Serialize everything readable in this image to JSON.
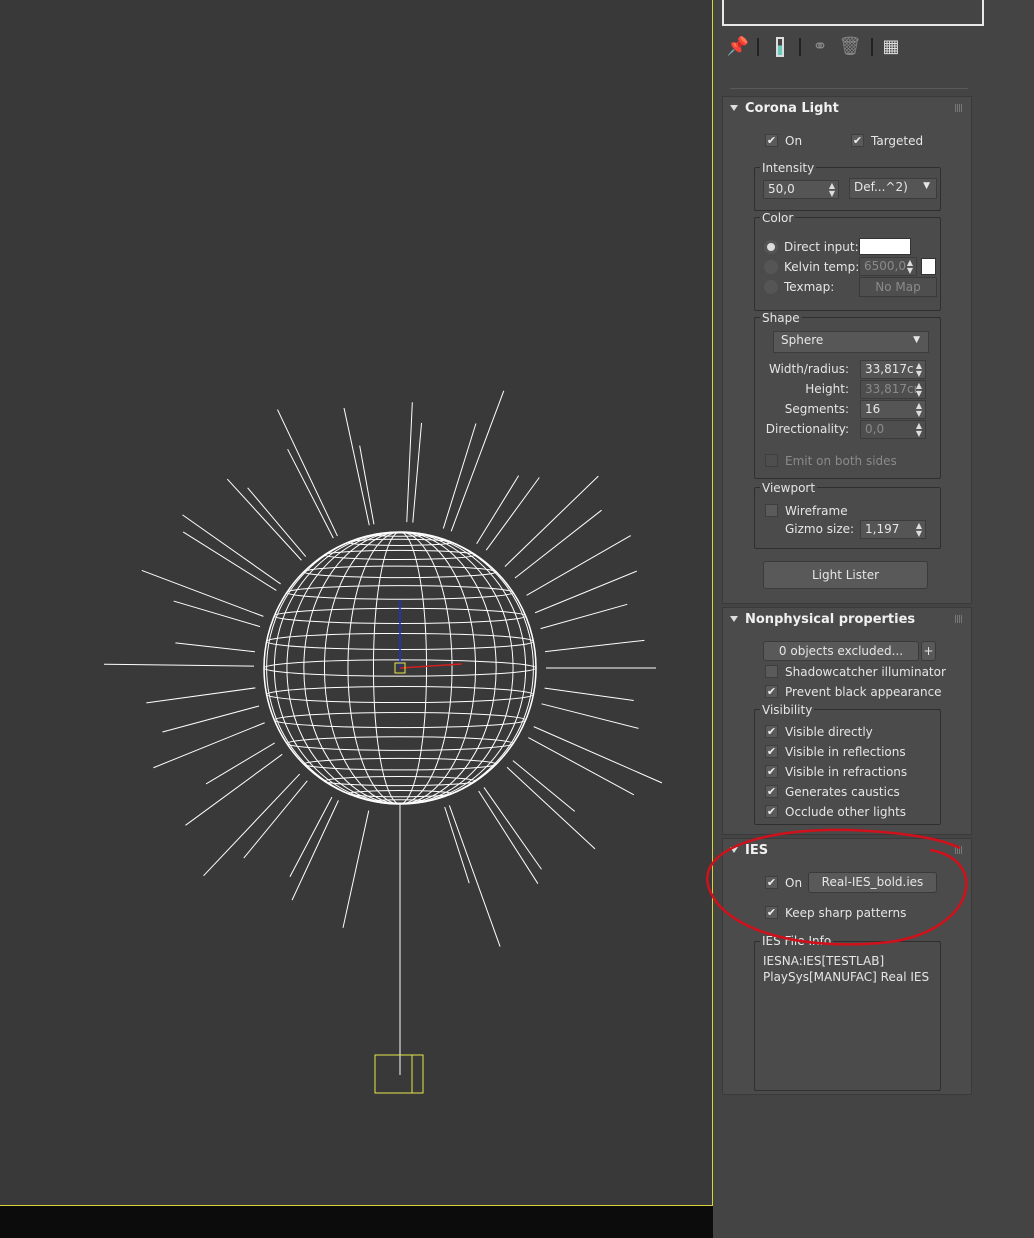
{
  "toolbar": {
    "icons": [
      "pin-icon",
      "show-end-result-icon",
      "make-unique-icon",
      "remove-modifier-icon",
      "configure-modifier-sets-icon"
    ]
  },
  "corona_light": {
    "title": "Corona Light",
    "on_label": "On",
    "on": true,
    "targeted_label": "Targeted",
    "targeted": true,
    "intensity_label": "Intensity",
    "intensity_value": "50,0",
    "intensity_unit": "Def...^2)",
    "color_label": "Color",
    "direct_input_label": "Direct input:",
    "kelvin_label": "Kelvin temp:",
    "kelvin_value": "6500,0",
    "texmap_label": "Texmap:",
    "texmap_button": "No Map",
    "shape_label": "Shape",
    "shape_value": "Sphere",
    "width_label": "Width/radius:",
    "width_value": "33,817c",
    "height_label": "Height:",
    "height_value": "33,817cı",
    "segments_label": "Segments:",
    "segments_value": "16",
    "directionality_label": "Directionality:",
    "directionality_value": "0,0",
    "emit_both_label": "Emit on both sides",
    "viewport_label": "Viewport",
    "wireframe_label": "Wireframe",
    "gizmo_label": "Gizmo size:",
    "gizmo_value": "1,197",
    "light_lister": "Light Lister"
  },
  "nonphysical": {
    "title": "Nonphysical properties",
    "excluded_button": "0 objects excluded...",
    "plus": "+",
    "shadowcatcher": "Shadowcatcher illuminator",
    "prevent_black": "Prevent black appearance",
    "visibility_label": "Visibility",
    "visibility": [
      "Visible directly",
      "Visible in reflections",
      "Visible in refractions",
      "Generates caustics",
      "Occlude other lights"
    ]
  },
  "ies": {
    "title": "IES",
    "on_label": "On",
    "file_button": "Real-IES_bold.ies",
    "keep_sharp": "Keep sharp patterns",
    "info_label": "IES File Info",
    "info_text": "IESNA:IES[TESTLAB]\nPlaySys[MANUFAC] Real IES"
  },
  "colors": {
    "viewport_border": "#d8d33a",
    "annotation": "#d0101a",
    "wire": "#ffffff",
    "target": "#e6e64a"
  }
}
